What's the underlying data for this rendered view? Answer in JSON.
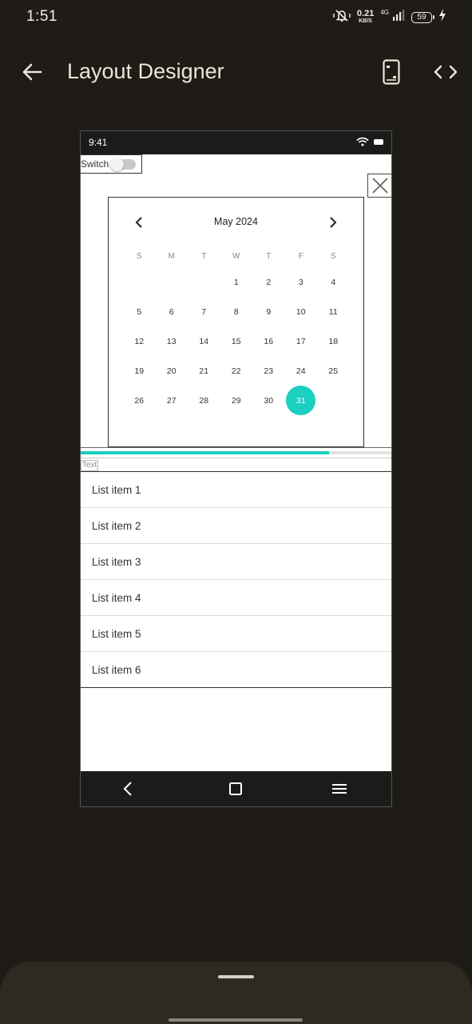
{
  "status_bar": {
    "time": "1:51",
    "speed_value": "0.21",
    "speed_unit": "KB/S",
    "network": "4G",
    "battery": "59",
    "icons": [
      "mute-vibrate-icon",
      "signal-icon",
      "battery-icon",
      "charging-icon"
    ]
  },
  "app_bar": {
    "title": "Layout Designer",
    "icons": [
      "back-arrow-icon",
      "device-icon",
      "code-icon"
    ]
  },
  "preview": {
    "status_time": "9:41",
    "switch_label": "Switch",
    "switch_on": false,
    "calendar": {
      "month_title": "May 2024",
      "weekdays": [
        "S",
        "M",
        "T",
        "W",
        "T",
        "F",
        "S"
      ],
      "weeks": [
        [
          "",
          "",
          "",
          "1",
          "2",
          "3",
          "4"
        ],
        [
          "5",
          "6",
          "7",
          "8",
          "9",
          "10",
          "11"
        ],
        [
          "12",
          "13",
          "14",
          "15",
          "16",
          "17",
          "18"
        ],
        [
          "19",
          "20",
          "21",
          "22",
          "23",
          "24",
          "25"
        ],
        [
          "26",
          "27",
          "28",
          "29",
          "30",
          "31",
          ""
        ]
      ],
      "selected_day": "31"
    },
    "progress_fraction": 0.8,
    "text_view": "Text",
    "list_items": [
      "List item 1",
      "List item 2",
      "List item 3",
      "List item 4",
      "List item 5",
      "List item 6"
    ],
    "accent_color": "#1bcfc1"
  }
}
